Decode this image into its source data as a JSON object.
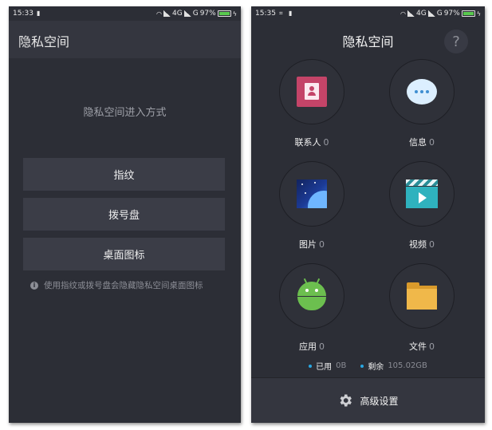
{
  "left": {
    "status": {
      "time": "15:33",
      "network": "4G",
      "network2": "G",
      "battery": "97%",
      "battery_level": 0.97
    },
    "title": "隐私空间",
    "entry_title": "隐私空间进入方式",
    "methods": [
      "指纹",
      "拨号盘",
      "桌面图标"
    ],
    "hint": "使用指纹或拨号盘会隐藏隐私空间桌面图标"
  },
  "right": {
    "status": {
      "time": "15:35",
      "network": "4G",
      "network2": "G",
      "battery": "97%",
      "battery_level": 0.97
    },
    "title": "隐私空间",
    "help": "?",
    "categories": [
      {
        "label": "联系人",
        "count": "0",
        "icon": "contacts-icon"
      },
      {
        "label": "信息",
        "count": "0",
        "icon": "messages-icon"
      },
      {
        "label": "图片",
        "count": "0",
        "icon": "photos-icon"
      },
      {
        "label": "视频",
        "count": "0",
        "icon": "videos-icon"
      },
      {
        "label": "应用",
        "count": "0",
        "icon": "android-app-icon"
      },
      {
        "label": "文件",
        "count": "0",
        "icon": "folder-icon"
      }
    ],
    "storage": {
      "used_label": "已用",
      "used_value": "0B",
      "free_label": "剩余",
      "free_value": "105.02GB"
    },
    "settings_label": "高级设置",
    "colors": {
      "accent": "#29a7e1",
      "background": "#2c2e36",
      "battery": "#59c94f"
    }
  }
}
